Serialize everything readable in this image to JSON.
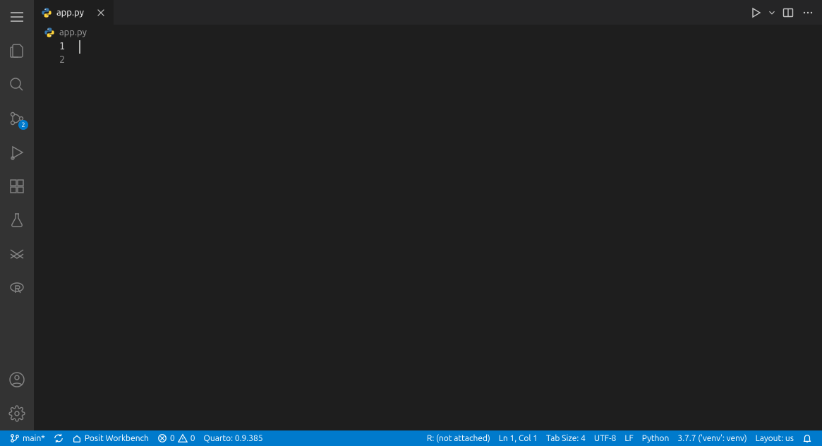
{
  "tab": {
    "filename": "app.py"
  },
  "breadcrumb": {
    "filename": "app.py"
  },
  "editor": {
    "line_numbers": [
      "1",
      "2"
    ],
    "cursor_line": 1
  },
  "activity": {
    "scm_badge": "2"
  },
  "status_left": {
    "branch": "main*",
    "workbench": "Posit Workbench",
    "errors": "0",
    "warnings": "0",
    "quarto": "Quarto: 0.9.385"
  },
  "status_right": {
    "r_status": "R: (not attached)",
    "cursor_pos": "Ln 1, Col 1",
    "tab_size": "Tab Size: 4",
    "encoding": "UTF-8",
    "eol": "LF",
    "lang": "Python",
    "py_version": "3.7.7 ('venv': venv)",
    "layout": "Layout: us"
  }
}
